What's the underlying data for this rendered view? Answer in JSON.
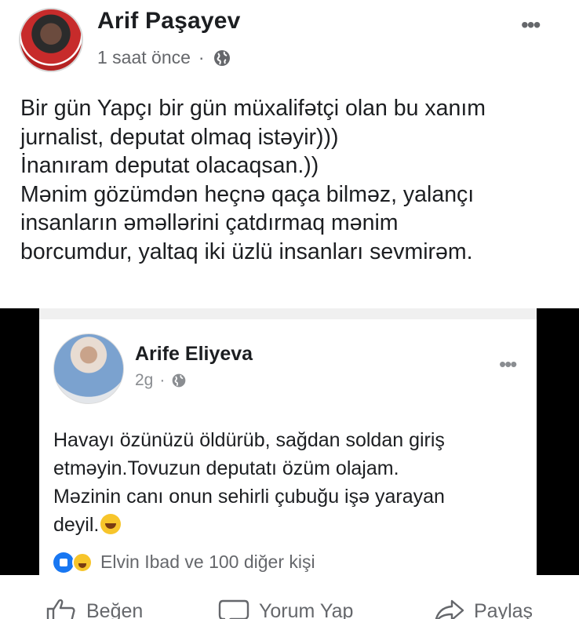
{
  "post": {
    "author": "Arif Paşayev",
    "time": "1 saat önce",
    "separator": "·",
    "text_lines": [
      "Bir gün Yapçı bir gün müxalifətçi olan bu xanım",
      "jurnalist, deputat olmaq istəyir)))",
      "İnanıram deputat olacaqsan.))",
      "Mənim gözümdən heçnə qaça bilməz, yalançı",
      "insanların  əməllərini çatdırmaq mənim",
      "borcumdur, yaltaq iki üzlü insanları sevmirəm."
    ],
    "more_label": "•••"
  },
  "shared": {
    "author": "Arife Eliyeva",
    "time": "2g",
    "separator": "·",
    "more_label": "•••",
    "text_lines": [
      "Havayı özünüzü öldürüb, sağdan soldan giriş",
      "etməyin.Tovuzun deputatı özüm olajam.",
      "Məzinin canı onun sehirli çubuğu işə yarayan",
      "deyil."
    ],
    "reactions_text": "Elvin Ibad ve 100 diğer kişi"
  },
  "actions": {
    "like": "Beğen",
    "comment": "Yorum Yap",
    "share": "Paylaş"
  },
  "icons": {
    "globe": "globe-icon",
    "like": "thumbs-up-icon",
    "comment": "comment-bubble-icon",
    "share": "share-arrow-icon",
    "more": "more-dots-icon"
  },
  "colors": {
    "text": "#1c1e21",
    "secondary": "#65676b",
    "like_blue": "#1877f2"
  }
}
